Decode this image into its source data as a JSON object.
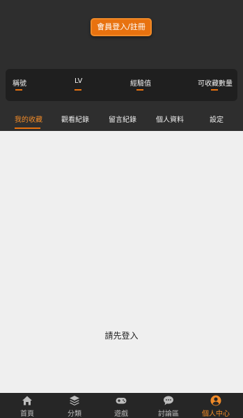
{
  "login": {
    "button_label": "會員登入/註冊"
  },
  "stats": [
    {
      "label": "稱號",
      "value": "—"
    },
    {
      "label": "LV",
      "value": "—"
    },
    {
      "label": "經驗值",
      "value": "—"
    },
    {
      "label": "可收藏數量",
      "value": "—"
    }
  ],
  "tabs": [
    {
      "label": "我的收藏",
      "active": true
    },
    {
      "label": "觀看紀錄",
      "active": false
    },
    {
      "label": "留言紀錄",
      "active": false
    },
    {
      "label": "個人資料",
      "active": false
    },
    {
      "label": "設定",
      "active": false
    }
  ],
  "content": {
    "empty_message": "請先登入"
  },
  "bottom_nav": [
    {
      "label": "首頁",
      "icon": "home-icon",
      "active": false
    },
    {
      "label": "分類",
      "icon": "layers-icon",
      "active": false
    },
    {
      "label": "遊戲",
      "icon": "gamepad-icon",
      "active": false
    },
    {
      "label": "討論區",
      "icon": "chat-bubble-icon",
      "active": false
    },
    {
      "label": "個人中心",
      "icon": "user-circle-icon",
      "active": true
    }
  ],
  "colors": {
    "accent": "#e8720f",
    "background_dark": "#2e2e2e",
    "content_bg": "#efefef"
  }
}
